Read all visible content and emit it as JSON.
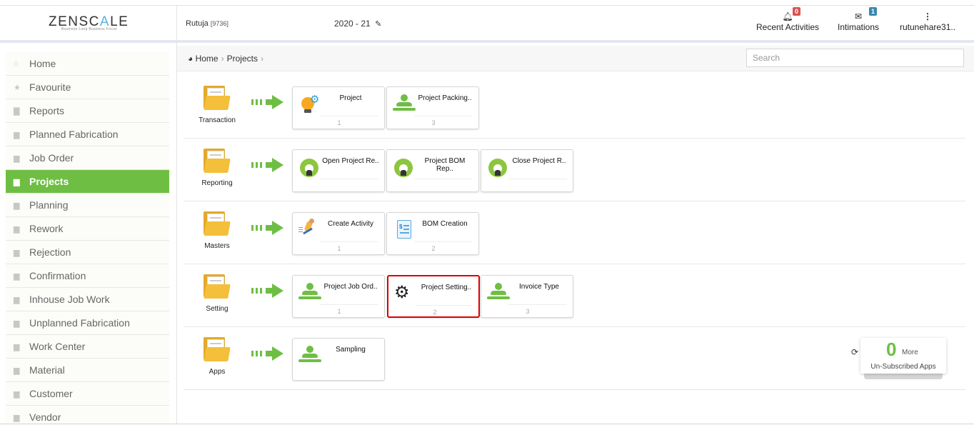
{
  "brand": {
    "logo_left": "ZENSC",
    "logo_accent": "A",
    "logo_right": "LE",
    "tagline": "Business Loop Business Focus"
  },
  "header": {
    "user_name": "Rutuja",
    "user_id": "[9736]",
    "year": "2020 - 21",
    "recent_activities": {
      "label": "Recent Activities",
      "badge": "0"
    },
    "intimations": {
      "label": "Intimations",
      "badge": "1"
    },
    "account": {
      "label": "rutunehare31.."
    }
  },
  "sidebar": {
    "items": [
      {
        "label": "Home",
        "icon": "home-icon"
      },
      {
        "label": "Favourite",
        "icon": "star-icon"
      },
      {
        "label": "Reports",
        "icon": "file-icon"
      },
      {
        "label": "Planned Fabrication",
        "icon": "folder-icon"
      },
      {
        "label": "Job Order",
        "icon": "folder-icon"
      },
      {
        "label": "Projects",
        "icon": "folder-icon",
        "active": true
      },
      {
        "label": "Planning",
        "icon": "folder-icon"
      },
      {
        "label": "Rework",
        "icon": "folder-icon"
      },
      {
        "label": "Rejection",
        "icon": "folder-icon"
      },
      {
        "label": "Confirmation",
        "icon": "folder-icon"
      },
      {
        "label": "Inhouse Job Work",
        "icon": "folder-icon"
      },
      {
        "label": "Unplanned Fabrication",
        "icon": "folder-icon"
      },
      {
        "label": "Work Center",
        "icon": "folder-icon"
      },
      {
        "label": "Material",
        "icon": "folder-icon"
      },
      {
        "label": "Customer",
        "icon": "folder-icon"
      },
      {
        "label": "Vendor",
        "icon": "folder-icon"
      }
    ]
  },
  "breadcrumb": {
    "home": "Home",
    "current": "Projects",
    "search_placeholder": "Search"
  },
  "categories": [
    {
      "label": "Transaction",
      "cards": [
        {
          "title": "Project",
          "num": "1",
          "icon": "lightbulb-gear-icon"
        },
        {
          "title": "Project Packing..",
          "num": "3",
          "icon": "user-icon"
        }
      ]
    },
    {
      "label": "Reporting",
      "cards": [
        {
          "title": "Open Project Re..",
          "num": "",
          "icon": "report-user-icon"
        },
        {
          "title": "Project BOM Rep..",
          "num": "",
          "icon": "report-user-icon"
        },
        {
          "title": "Close Project R..",
          "num": "",
          "icon": "report-user-icon"
        }
      ]
    },
    {
      "label": "Masters",
      "cards": [
        {
          "title": "Create Activity",
          "num": "1",
          "icon": "runner-icon"
        },
        {
          "title": "BOM Creation",
          "num": "2",
          "icon": "document-dollar-icon"
        }
      ]
    },
    {
      "label": "Setting",
      "cards": [
        {
          "title": "Project Job Ord..",
          "num": "1",
          "icon": "user-icon"
        },
        {
          "title": "Project Setting..",
          "num": "2",
          "icon": "gear-icon",
          "selected": true
        },
        {
          "title": "Invoice Type",
          "num": "3",
          "icon": "user-icon"
        }
      ]
    },
    {
      "label": "Apps",
      "cards": [
        {
          "title": "Sampling",
          "num": "",
          "icon": "user-icon"
        }
      ]
    }
  ],
  "unsubscribed": {
    "count": "0",
    "more": "More",
    "label": "Un-Subscribed Apps"
  }
}
